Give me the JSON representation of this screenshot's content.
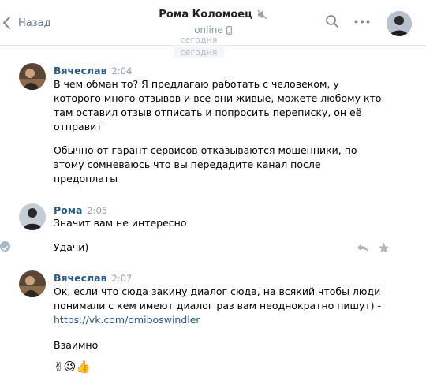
{
  "header": {
    "back_label": "Назад",
    "title": "Рома Коломоец",
    "status": "online"
  },
  "float_date": {
    "line1": "сегодня",
    "line2": "сегодня"
  },
  "messages": [
    {
      "author": "Вячеслав",
      "time": "2:04",
      "paragraphs": [
        "В чем обман то? Я предлагаю работать с человеком, у которого много отзывов и все они живые, можете любому кто там оставил отзыв отписать и попросить переписку, он её отправит",
        "Обычно от гарант сервисов отказываются мошенники, по этому сомневаюсь что вы передадите канал после предоплаты"
      ]
    },
    {
      "author": "Рома",
      "time": "2:05",
      "paragraphs": [
        "Значит вам не интересно",
        "Удачи)"
      ]
    },
    {
      "author": "Вячеслав",
      "time": "2:07",
      "paragraphs": [
        "Ок, если что сюда закину диалог сюда, на всякий чтобы люди понимали с кем имеют диалог раз вам неоднократно пишут) -",
        "https://vk.com/omiboswindler",
        "Взаимно",
        "✌😉👍"
      ]
    }
  ]
}
